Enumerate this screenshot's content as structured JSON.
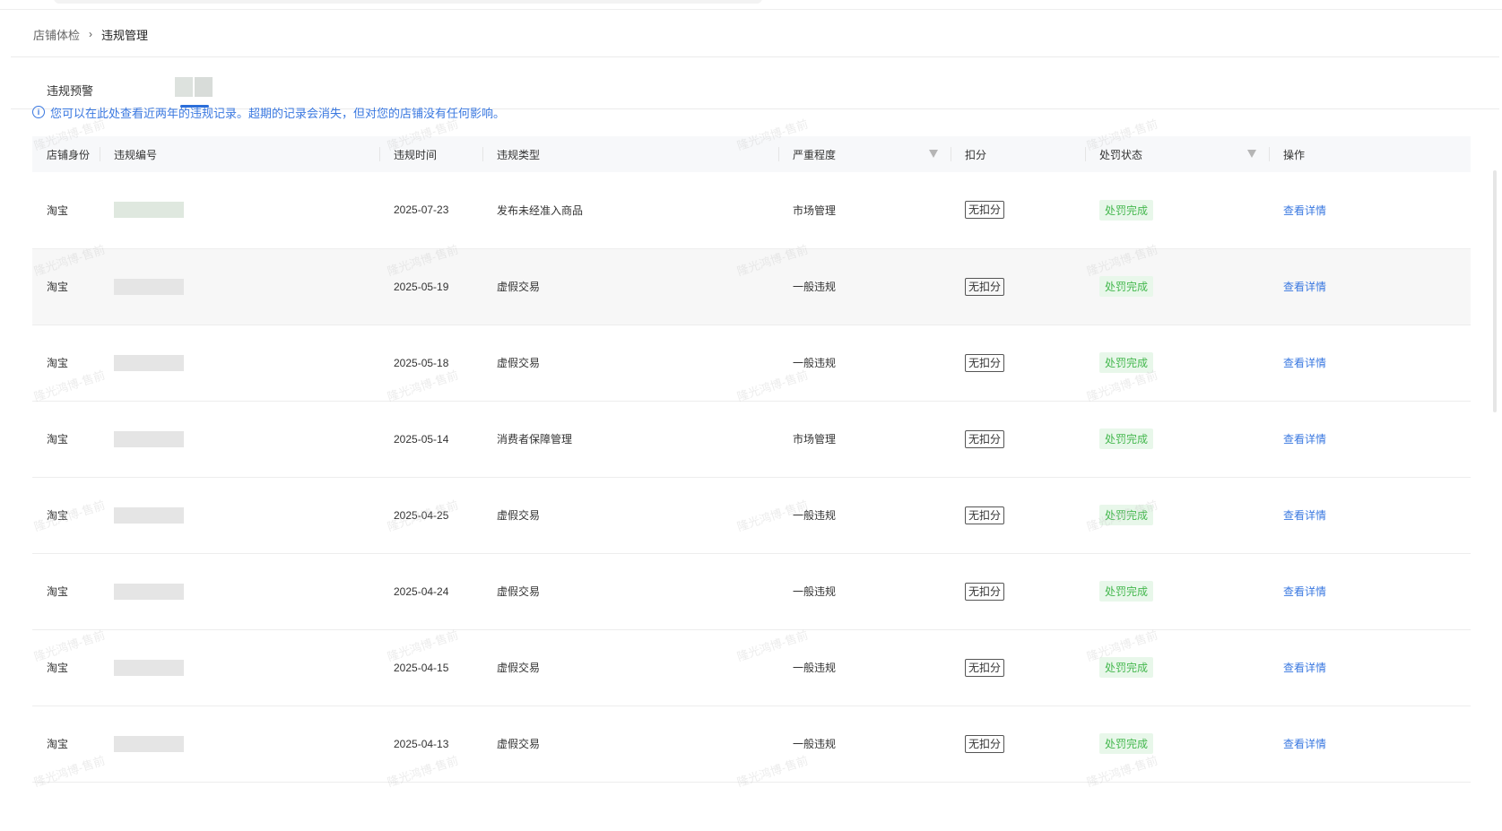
{
  "breadcrumb": {
    "parent": "店铺体检",
    "separator": "›",
    "current": "违规管理"
  },
  "tabs": {
    "active_label": "违规预警"
  },
  "notice": {
    "icon": "info-icon",
    "text": "您可以在此处查看近两年的违规记录。超期的记录会消失，但对您的店铺没有任何影响。"
  },
  "table": {
    "headers": {
      "shop_identity": "店铺身份",
      "violation_id": "违规编号",
      "violation_time": "违规时间",
      "violation_type": "违规类型",
      "severity": "严重程度",
      "deduction": "扣分",
      "penalty_status": "处罚状态",
      "action": "操作"
    },
    "rows": [
      {
        "shop": "淘宝",
        "date": "2025-07-23",
        "type": "发布未经准入商品",
        "severity": "市场管理",
        "deduction": "无扣分",
        "status": "处罚完成",
        "action": "查看详情"
      },
      {
        "shop": "淘宝",
        "date": "2025-05-19",
        "type": "虚假交易",
        "severity": "一般违规",
        "deduction": "无扣分",
        "status": "处罚完成",
        "action": "查看详情"
      },
      {
        "shop": "淘宝",
        "date": "2025-05-18",
        "type": "虚假交易",
        "severity": "一般违规",
        "deduction": "无扣分",
        "status": "处罚完成",
        "action": "查看详情"
      },
      {
        "shop": "淘宝",
        "date": "2025-05-14",
        "type": "消费者保障管理",
        "severity": "市场管理",
        "deduction": "无扣分",
        "status": "处罚完成",
        "action": "查看详情"
      },
      {
        "shop": "淘宝",
        "date": "2025-04-25",
        "type": "虚假交易",
        "severity": "一般违规",
        "deduction": "无扣分",
        "status": "处罚完成",
        "action": "查看详情"
      },
      {
        "shop": "淘宝",
        "date": "2025-04-24",
        "type": "虚假交易",
        "severity": "一般违规",
        "deduction": "无扣分",
        "status": "处罚完成",
        "action": "查看详情"
      },
      {
        "shop": "淘宝",
        "date": "2025-04-15",
        "type": "虚假交易",
        "severity": "一般违规",
        "deduction": "无扣分",
        "status": "处罚完成",
        "action": "查看详情"
      },
      {
        "shop": "淘宝",
        "date": "2025-04-13",
        "type": "虚假交易",
        "severity": "一般违规",
        "deduction": "无扣分",
        "status": "处罚完成",
        "action": "查看详情"
      }
    ]
  },
  "watermark": "隆光鸿博-售前",
  "colors": {
    "link": "#3a78e0",
    "status_green": "#45b84f",
    "status_bg": "#e8f7ea"
  }
}
